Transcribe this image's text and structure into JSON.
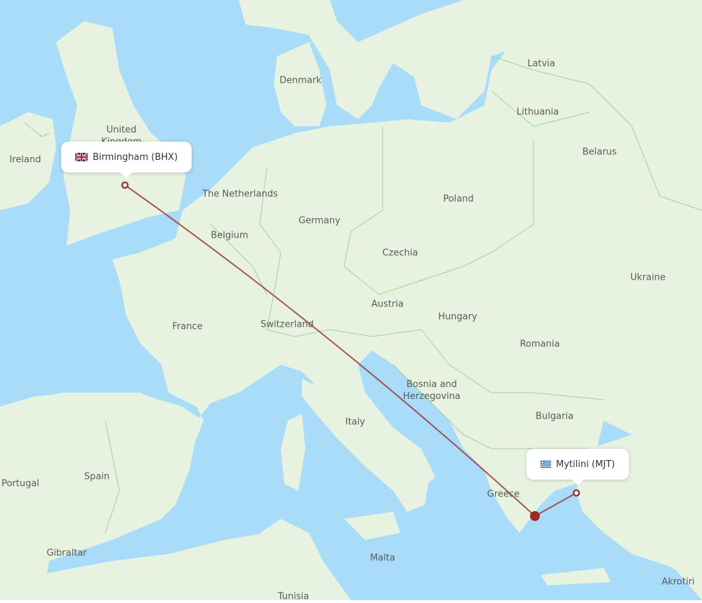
{
  "map": {
    "colors": {
      "sea": "#a8dcf8",
      "land": "#e8f2e0",
      "land_dark": "#dcebd2",
      "border": "#9fd19a",
      "route": "#9b3b3b",
      "marker_fill": "#9b2a2a"
    },
    "country_labels": [
      {
        "id": "ireland",
        "text": "Ireland"
      },
      {
        "id": "united-kingdom",
        "text": "United Kingdom"
      },
      {
        "id": "denmark",
        "text": "Denmark"
      },
      {
        "id": "netherlands",
        "text": "The Netherlands"
      },
      {
        "id": "belgium",
        "text": "Belgium"
      },
      {
        "id": "germany",
        "text": "Germany"
      },
      {
        "id": "france",
        "text": "France"
      },
      {
        "id": "switzerland",
        "text": "Switzerland"
      },
      {
        "id": "austria",
        "text": "Austria"
      },
      {
        "id": "czechia",
        "text": "Czechia"
      },
      {
        "id": "poland",
        "text": "Poland"
      },
      {
        "id": "latvia",
        "text": "Latvia"
      },
      {
        "id": "lithuania",
        "text": "Lithuania"
      },
      {
        "id": "belarus",
        "text": "Belarus"
      },
      {
        "id": "ukraine",
        "text": "Ukraine"
      },
      {
        "id": "hungary",
        "text": "Hungary"
      },
      {
        "id": "romania",
        "text": "Romania"
      },
      {
        "id": "bosnia",
        "text": "Bosnia and Herzegovina"
      },
      {
        "id": "italy",
        "text": "Italy"
      },
      {
        "id": "bulgaria",
        "text": "Bulgaria"
      },
      {
        "id": "greece",
        "text": "Greece"
      },
      {
        "id": "spain",
        "text": "Spain"
      },
      {
        "id": "portugal",
        "text": "Portugal"
      },
      {
        "id": "gibraltar",
        "text": "Gibraltar"
      },
      {
        "id": "malta",
        "text": "Malta"
      },
      {
        "id": "tunisia",
        "text": "Tunisia"
      },
      {
        "id": "akrotiri",
        "text": "Akrotiri"
      }
    ],
    "origin": {
      "name": "Birmingham (BHX)",
      "flag": "uk-flag-icon"
    },
    "destination": {
      "name": "Mytilini (MJT)",
      "flag": "greece-flag-icon"
    },
    "stopover_marker": "athens-marker"
  }
}
